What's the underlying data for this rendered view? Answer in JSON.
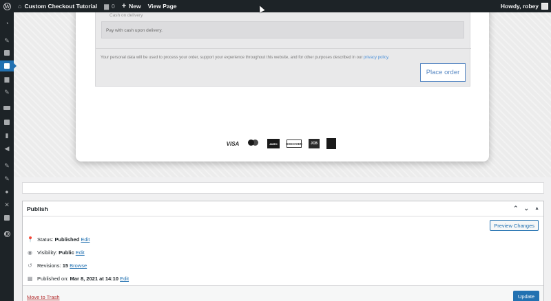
{
  "admin_bar": {
    "site_name": "Custom Checkout Tutorial",
    "comments_count": "0",
    "new_label": "New",
    "view_page_label": "View Page",
    "howdy_label": "Howdy, robey"
  },
  "admin_menu": {
    "icons": [
      "dashboard-icon",
      "pin-icon",
      "media-icon",
      "pages-icon",
      "comments-icon",
      "pin-icon",
      "woocommerce-icon",
      "products-icon",
      "analytics-icon",
      "marketing-icon",
      "appearance-icon",
      "plugins-icon",
      "users-icon",
      "tools-icon",
      "settings-icon",
      "custom-icon"
    ],
    "current_index": 3
  },
  "preview": {
    "payment_note": "Pay with cash upon delivery.",
    "privacy_text": "Your personal data will be used to process your order, support your experience throughout this website, and for other purposes described in our ",
    "privacy_link": "privacy policy.",
    "place_order_label": "Place order",
    "payment_methods": [
      "VISA",
      "mastercard",
      "AMEX",
      "DISCOVER",
      "JCB",
      "Apple Pay"
    ]
  },
  "publish": {
    "title": "Publish",
    "preview_changes_label": "Preview Changes",
    "status_label": "Status:",
    "status_value": "Published",
    "visibility_label": "Visibility:",
    "visibility_value": "Public",
    "revisions_label": "Revisions:",
    "revisions_value": "15",
    "browse_label": "Browse",
    "published_on_label": "Published on:",
    "published_on_value": "Mar 8, 2021 at 14:10",
    "edit_label": "Edit",
    "move_to_trash_label": "Move to Trash",
    "update_label": "Update"
  },
  "colors": {
    "admin_bar_bg": "#1d2327",
    "accent": "#2271b1",
    "trash": "#b32d2e"
  }
}
